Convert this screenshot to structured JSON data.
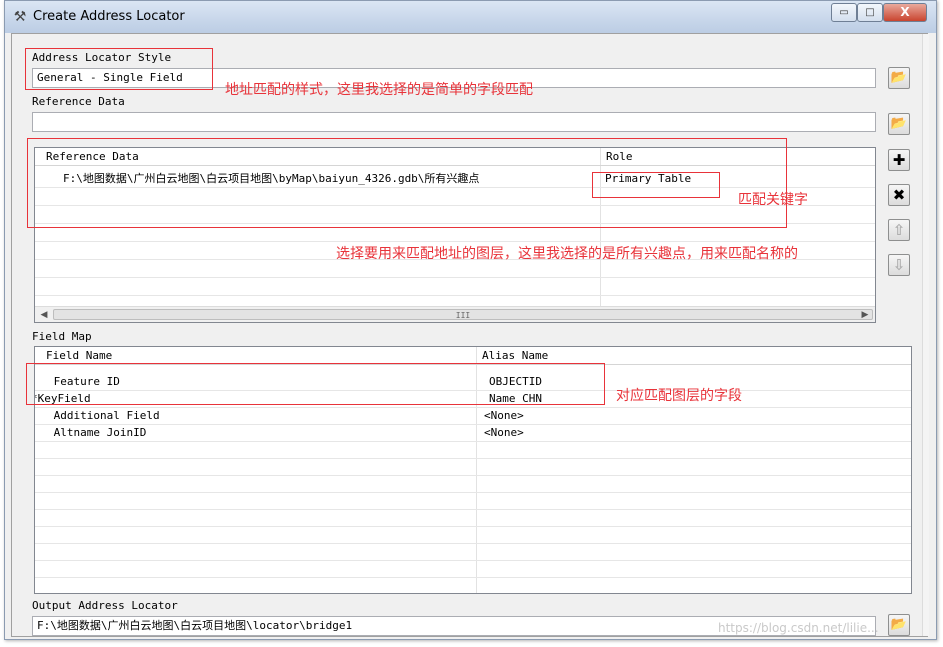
{
  "window": {
    "title": "Create Address Locator",
    "controls": {
      "minimize": "▭",
      "maximize": "□",
      "close": "X"
    }
  },
  "locator_style": {
    "label": "Address Locator Style",
    "value": "General - Single Field"
  },
  "reference_data": {
    "label": "Reference Data",
    "value": "",
    "table": {
      "columns": [
        "Reference Data",
        "Role"
      ],
      "rows": [
        {
          "path": "F:\\地图数据\\广州白云地图\\白云项目地图\\byMap\\baiyun_4326.gdb\\所有兴趣点",
          "role": "Primary Table"
        }
      ]
    },
    "hscroll_grip": "III"
  },
  "field_map": {
    "label": "Field Map",
    "columns": [
      "Field Name",
      "Alias Name"
    ],
    "rows": [
      {
        "field": " Feature ID",
        "alias": "OBJECTID"
      },
      {
        "field": "*KeyField",
        "alias": "Name_CHN"
      },
      {
        "field": " Additional Field",
        "alias": "<None>"
      },
      {
        "field": " Altname JoinID",
        "alias": "<None>"
      }
    ]
  },
  "output": {
    "label": "Output Address Locator",
    "value": "F:\\地图数据\\广州白云地图\\白云项目地图\\locator\\bridge1"
  },
  "annotations": {
    "style_note": "地址匹配的样式，这里我选择的是简单的字段匹配",
    "keyword_note": "匹配关键字",
    "layer_note": "选择要用来匹配地址的图层，这里我选择的是所有兴趣点，用来匹配名称的",
    "fields_note": "对应匹配图层的字段"
  },
  "icons": {
    "app": "hammer-icon",
    "folder": "folder-open-icon",
    "add": "plus-icon",
    "remove": "close-icon",
    "up": "arrow-up-icon",
    "down": "arrow-down-icon"
  },
  "watermark": "https://blog.csdn.net/lilie..."
}
